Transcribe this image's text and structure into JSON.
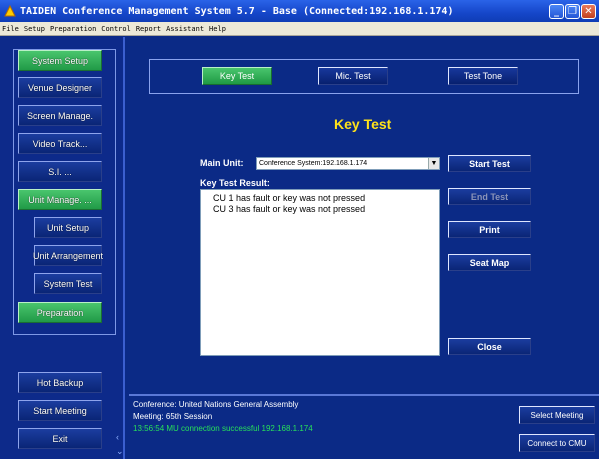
{
  "window": {
    "title": "TAIDEN Conference Management System 5.7 - Base (Connected:192.168.1.174)",
    "controls": [
      "minimize-icon",
      "restore-icon",
      "close-icon"
    ]
  },
  "menu": [
    "File",
    "Setup",
    "Preparation",
    "Control",
    "Report",
    "Assistant",
    "Help"
  ],
  "sidebar": {
    "items": [
      {
        "label": "System Setup",
        "active": true
      },
      {
        "label": "Venue Designer"
      },
      {
        "label": "Screen Manage."
      },
      {
        "label": "Video Track..."
      },
      {
        "label": "S.I. ..."
      },
      {
        "label": "Unit Manage. ...",
        "active": true
      },
      {
        "label": "Unit Setup"
      },
      {
        "label": "Unit Arrangement"
      },
      {
        "label": "System Test"
      },
      {
        "label": "Preparation",
        "active": true
      }
    ],
    "bottom": [
      "Hot Backup",
      "Start Meeting",
      "Exit"
    ]
  },
  "tabs": [
    {
      "label": "Key Test",
      "active": true
    },
    {
      "label": "Mic. Test"
    },
    {
      "label": "Test Tone"
    }
  ],
  "main": {
    "heading": "Key Test",
    "main_unit_label": "Main Unit:",
    "main_unit_value": "Conference System:192.168.1.174",
    "result_label": "Key Test Result:",
    "results": [
      "CU 1 has fault or key was not pressed",
      "CU 3 has fault or key was not pressed"
    ],
    "buttons": {
      "start": "Start Test",
      "end": "End Test",
      "print": "Print",
      "seat_map": "Seat Map",
      "close": "Close"
    }
  },
  "status": {
    "conference": "Conference: United Nations General Assembly",
    "meeting": "Meeting: 65th Session",
    "log": "13:56:54 MU connection successful 192.168.1.174",
    "select_meeting": "Select Meeting",
    "connect": "Connect to CMU"
  },
  "colors": {
    "background": "#0b2a86",
    "active_green": "#2fae57",
    "heading_yellow": "#ffe21a",
    "status_ok": "#27e05a"
  }
}
